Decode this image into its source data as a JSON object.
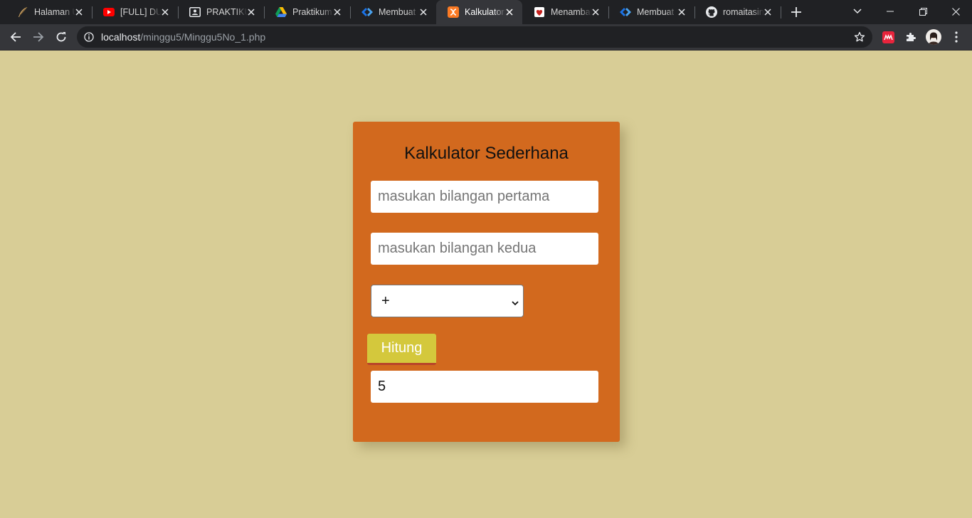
{
  "browser": {
    "tabs": [
      {
        "title": "Halaman Utama",
        "icon": "feather-icon",
        "active": false
      },
      {
        "title": "[FULL] DUBBING",
        "icon": "youtube-icon",
        "active": false
      },
      {
        "title": "PRAKTIKUM",
        "icon": "classroom-icon",
        "active": false
      },
      {
        "title": "Praktikum",
        "icon": "google-drive-icon",
        "active": false
      },
      {
        "title": "Membuat",
        "icon": "code-icon",
        "active": false
      },
      {
        "title": "Kalkulator",
        "icon": "xampp-icon",
        "active": true
      },
      {
        "title": "Menambah",
        "icon": "heart-icon",
        "active": false
      },
      {
        "title": "Membuat",
        "icon": "code-icon",
        "active": false
      },
      {
        "title": "romaitasin",
        "icon": "github-icon",
        "active": false
      }
    ],
    "url_host": "localhost",
    "url_path": "/minggu5/Minggu5No_1.php"
  },
  "page": {
    "title": "Kalkulator Sederhana",
    "input1_placeholder": "masukan bilangan pertama",
    "input2_placeholder": "masukan bilangan kedua",
    "operator_selected": "+",
    "button_label": "Hitung",
    "result_value": "5"
  },
  "colors": {
    "page_background": "#d8cd96",
    "card_background": "#d2691e",
    "button_background": "#d4c83c"
  }
}
